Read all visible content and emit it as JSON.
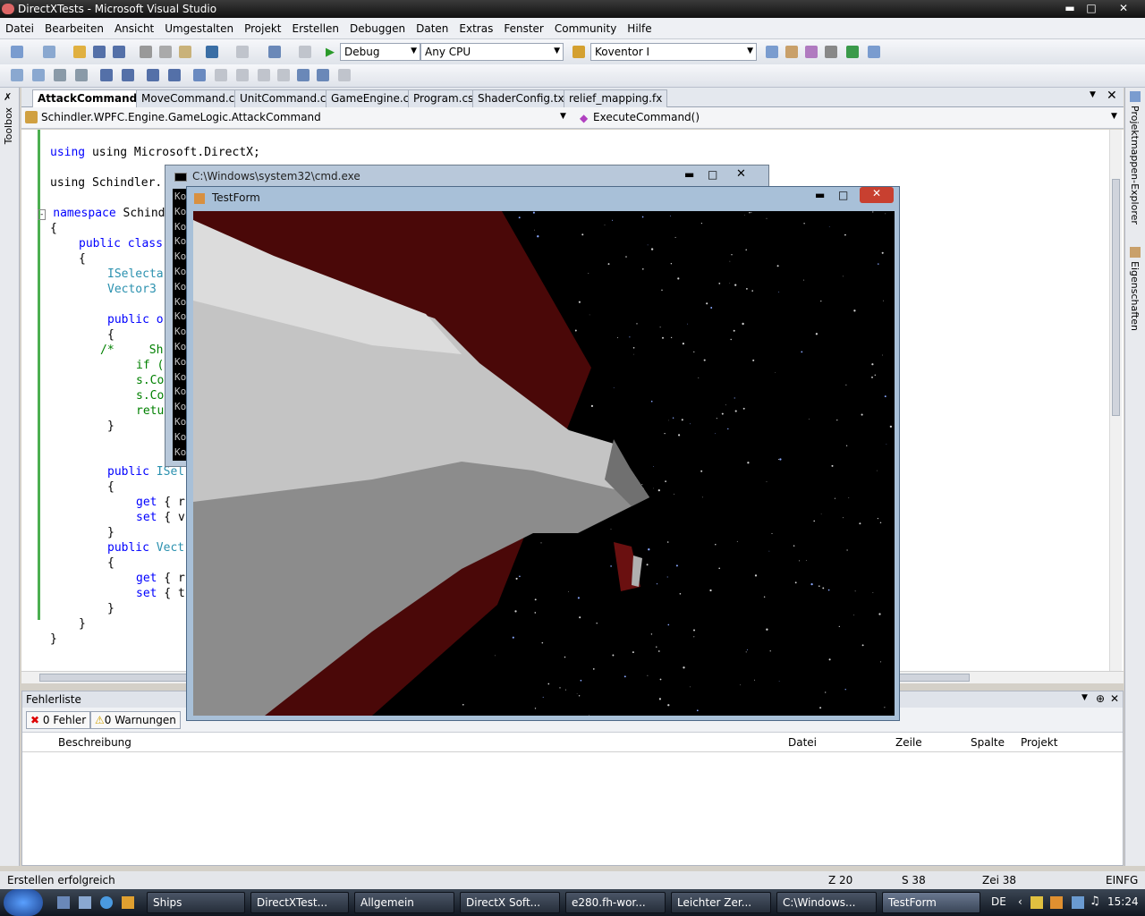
{
  "window": {
    "title": "DirectXTests - Microsoft Visual Studio"
  },
  "menu": [
    "Datei",
    "Bearbeiten",
    "Ansicht",
    "Umgestalten",
    "Projekt",
    "Erstellen",
    "Debuggen",
    "Daten",
    "Extras",
    "Fenster",
    "Community",
    "Hilfe"
  ],
  "toolbar": {
    "config": "Debug",
    "platform": "Any CPU",
    "find": "Koventor I"
  },
  "side": {
    "toolbox": "Toolbox",
    "solution_explorer": "Projektmappen-Explorer",
    "properties": "Eigenschaften"
  },
  "tabs": [
    "AttackCommand.cs",
    "MoveCommand.cs",
    "UnitCommand.cs",
    "GameEngine.cs",
    "Program.cs",
    "ShaderConfig.txt",
    "relief_mapping.fx"
  ],
  "nav": {
    "type": "Schindler.WPFC.Engine.GameLogic.AttackCommand",
    "member": "ExecuteCommand()"
  },
  "code": {
    "l1": "using Microsoft.DirectX;",
    "l2": "using Schindler.",
    "l3_kw": "namespace",
    "l3": " Schind",
    "l4": "{",
    "l5_kw": "public class",
    "l6": "{",
    "l7": "ISelecta",
    "l8": "Vector3",
    "l9_kw": "public",
    "l9": " o",
    "l10": "{",
    "l11": "/*     Sh",
    "l12": "if (",
    "l13": "s.Co",
    "l14": "s.Co",
    "l15": "retu",
    "l16": "}",
    "l17_kw": "public",
    "l17": " ISel",
    "l18": "{",
    "l19_kw": "get",
    "l19": " { r",
    "l20_kw": "set",
    "l20": " { v",
    "l21": "}",
    "l22_kw": "public",
    "l22": " Vect",
    "l23": "{",
    "l24_kw": "get",
    "l24": " { r",
    "l25_kw": "set",
    "l25": " { t",
    "l26": "}",
    "l27": "}",
    "l28": "}"
  },
  "errors": {
    "title": "Fehlerliste",
    "err": "0 Fehler",
    "warn": "0 Warnungen",
    "cols": [
      "Beschreibung",
      "Datei",
      "Zeile",
      "Spalte",
      "Projekt"
    ]
  },
  "status": {
    "msg": "Erstellen erfolgreich",
    "z": "Z 20",
    "s": "S 38",
    "zei": "Zei 38",
    "mode": "EINFG"
  },
  "cmd": {
    "title": "C:\\Windows\\system32\\cmd.exe",
    "prefix": "Ko"
  },
  "testform": {
    "title": "TestForm"
  },
  "taskbar": {
    "items": [
      "Ships",
      "DirectXTest...",
      "Allgemein",
      "DirectX Soft...",
      "e280.fh-wor...",
      "Leichter Zer...",
      "C:\\Windows...",
      "TestForm"
    ],
    "lang": "DE",
    "clock": "15:24"
  },
  "colors": {
    "accent": "#3a6ea5",
    "ship": "#c8c8c8",
    "space": "#000000",
    "red": "#5a0a0a"
  }
}
